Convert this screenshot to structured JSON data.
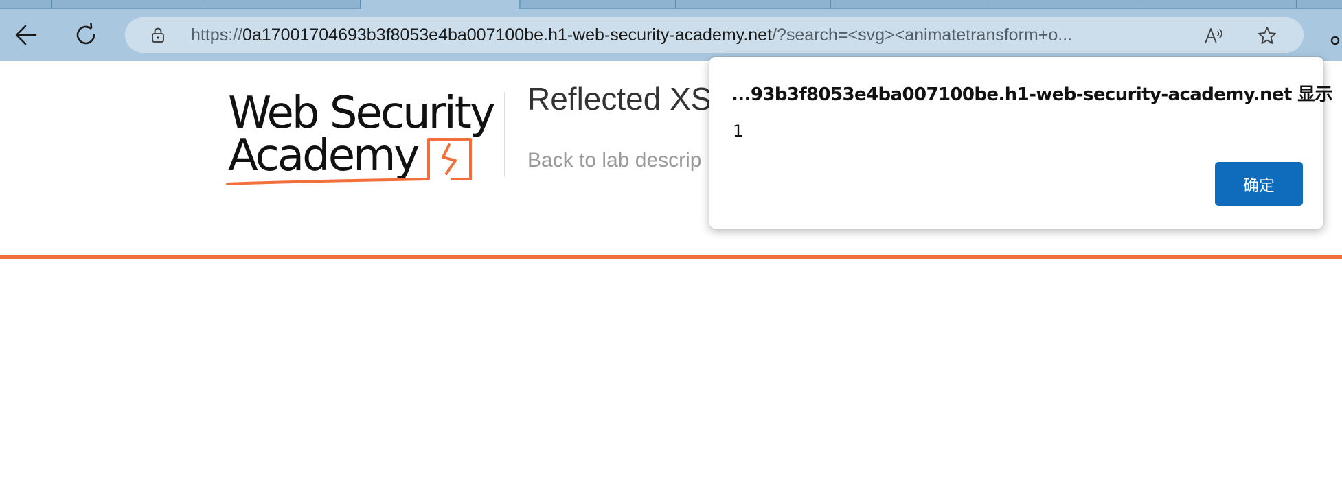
{
  "browser": {
    "url_prefix": "https://",
    "url_host": "0a17001704693b3f8053e4ba007100be.h1-web-security-academy.net",
    "url_rest": "/?search=<svg><animatetransform+o...",
    "icons": {
      "back": "arrow-left-icon",
      "refresh": "refresh-icon",
      "lock": "lock-icon",
      "read_aloud": "read-aloud-icon",
      "favorite": "star-icon",
      "menu": "more-icon"
    }
  },
  "page": {
    "logo_line1": "Web Security",
    "logo_line2": "Academy",
    "lab_title": "Reflected XS",
    "back_link": "Back to lab descrip",
    "accent_color": "#f26e3a"
  },
  "dialog": {
    "title": "...93b3f8053e4ba007100be.h1-web-security-academy.net 显示",
    "message": "1",
    "ok_label": "确定",
    "button_color": "#0f6cbd"
  }
}
